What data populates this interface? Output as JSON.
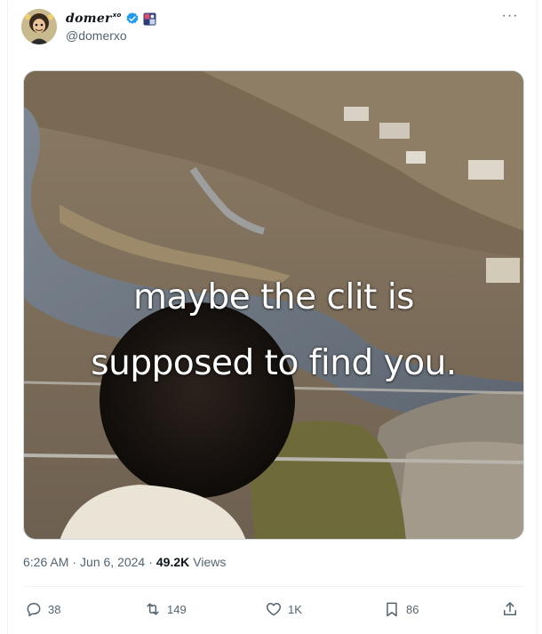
{
  "author": {
    "display_name": "domer",
    "name_suffix": "xo",
    "handle": "@domerxo",
    "verified": true,
    "avatar_icon": "avatar-cartoon",
    "badge_icon": "affiliate-badge-icon"
  },
  "menu": {
    "more_icon": "more-horizontal-icon",
    "more_label": "···"
  },
  "media": {
    "caption_line1": "maybe the clit is",
    "caption_line2": "supposed to find you."
  },
  "meta": {
    "time": "6:26 AM",
    "separator": "·",
    "date": "Jun 6, 2024",
    "views_count": "49.2K",
    "views_label": "Views"
  },
  "actions": {
    "reply_count": "38",
    "retweet_count": "149",
    "like_count": "1K",
    "bookmark_count": "86",
    "share_icon": "share-icon"
  },
  "colors": {
    "text_primary": "#0f1419",
    "text_secondary": "#536471",
    "verified_blue": "#1d9bf0",
    "border": "#eff3f4"
  }
}
